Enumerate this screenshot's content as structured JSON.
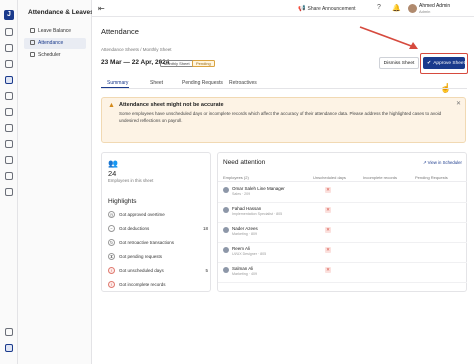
{
  "app": {
    "section_title": "Attendance & Leaves",
    "logo_letter": "J"
  },
  "sidebar": {
    "items": [
      {
        "label": "Leave Balance",
        "active": false
      },
      {
        "label": "Attendance",
        "active": true
      },
      {
        "label": "Scheduler",
        "active": false
      }
    ]
  },
  "topbar": {
    "share_label": "Share Announcement",
    "user_name": "Ahmed Admin",
    "user_role": "Admin"
  },
  "page": {
    "title": "Attendance",
    "breadcrumb": "Attendance Sheets / Monthly Sheet",
    "period": "23 Mar — 22 Apr, 2024",
    "badge_type": "Monthly Sheet",
    "badge_status": "Pending",
    "dismiss_label": "Dismiss Sheet",
    "approve_label": "Approve Sheet"
  },
  "tabs": [
    {
      "label": "Summary",
      "active": true
    },
    {
      "label": "Sheet",
      "active": false
    },
    {
      "label": "Pending Requests",
      "active": false
    },
    {
      "label": "Retroactives",
      "active": false
    }
  ],
  "alert": {
    "title": "Attendance sheet might not be accurate",
    "body": "Some employees have unscheduled days or incomplete records which affect the accuracy of their attendance data. Please address the highlighted cases to avoid undesired reflections on payroll."
  },
  "summary": {
    "employee_count": "24",
    "employee_label": "Employees in this sheet",
    "highlights_title": "Highlights",
    "highlights": [
      {
        "label": "Got approved overtime",
        "value": "",
        "alert": false,
        "icon": "clock-icon"
      },
      {
        "label": "Got deductions",
        "value": "18",
        "alert": false,
        "icon": "minus-icon"
      },
      {
        "label": "Got retroactive transactions",
        "value": "",
        "alert": false,
        "icon": "refresh-icon"
      },
      {
        "label": "Got pending requests",
        "value": "",
        "alert": false,
        "icon": "hourglass-icon"
      },
      {
        "label": "Got unscheduled days",
        "value": "5",
        "alert": true,
        "icon": "calendar-icon"
      },
      {
        "label": "Got incomplete records",
        "value": "",
        "alert": true,
        "icon": "warning-icon"
      }
    ]
  },
  "attention": {
    "title": "Need attention",
    "view_link": "View in Scheduler",
    "columns": [
      "Employees (2)",
      "Unscheduled days",
      "Incomplete records",
      "Pending Requests"
    ],
    "rows": [
      {
        "name": "Omar Saleh Line Manager",
        "role": "Sales · 209"
      },
      {
        "name": "Fahad Hassan",
        "role": "Implementation Specialist · 805"
      },
      {
        "name": "Nader Azees",
        "role": "Marketing · 809"
      },
      {
        "name": "Reem Ali",
        "role": "UI/UX Designer · 805"
      },
      {
        "name": "Salman Ali",
        "role": "Marketing · 409"
      }
    ]
  },
  "colors": {
    "primary": "#1a3a8c",
    "warning_bg": "#fdf3e5",
    "danger": "#d64a3e"
  }
}
